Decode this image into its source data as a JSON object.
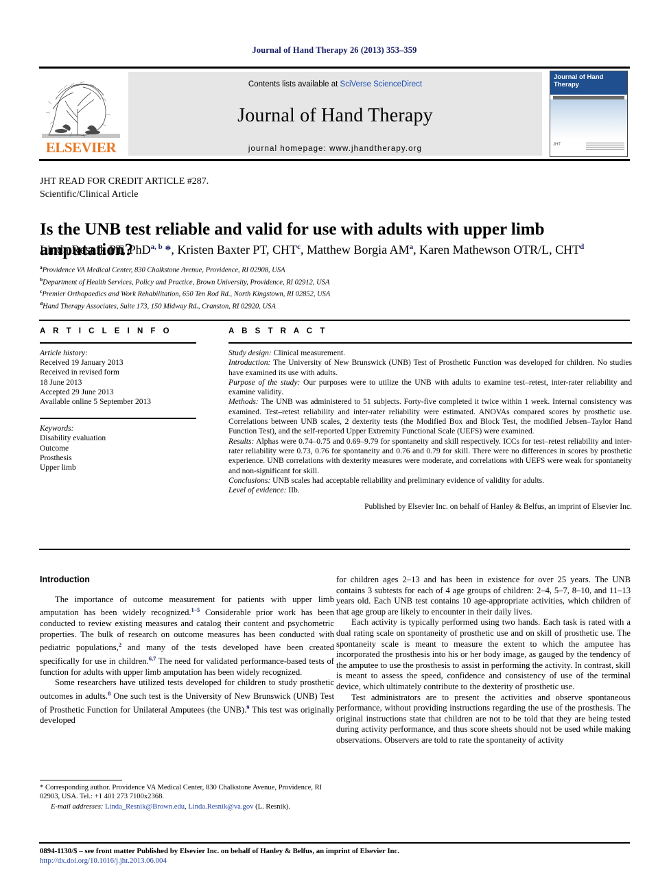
{
  "running_head": "Journal of Hand Therapy 26 (2013) 353–359",
  "masthead": {
    "contents_prefix": "Contents lists available at ",
    "contents_link": "SciVerse ScienceDirect",
    "journal_name": "Journal of Hand Therapy",
    "homepage": "journal homepage: www.jhandtherapy.org",
    "publisher_logo_text": "ELSEVIER",
    "cover_title": "Journal of Hand Therapy"
  },
  "article_type": {
    "line1_prefix": "JHT R",
    "line1_sc1": "EAD FOR",
    "line1_mid": " C",
    "line1_sc2": "REDIT",
    "line1_mid2": " A",
    "line1_sc3": "RTICLE",
    "line1_suffix": " #287.",
    "line2": "Scientific/Clinical Article"
  },
  "title": "Is the UNB test reliable and valid for use with adults with upper limb amputation?",
  "authors": [
    {
      "name": "Linda Resnik PT, PhD",
      "sup": "a, b",
      "star": true
    },
    {
      "name": "Kristen Baxter PT, CHT",
      "sup": "c",
      "star": false
    },
    {
      "name": "Matthew Borgia AM",
      "sup": "a",
      "star": false
    },
    {
      "name": "Karen Mathewson OTR/L, CHT",
      "sup": "d",
      "star": false
    }
  ],
  "affiliations": [
    {
      "mark": "a",
      "text": "Providence VA Medical Center, 830 Chalkstone Avenue, Providence, RI 02908, USA"
    },
    {
      "mark": "b",
      "text": "Department of Health Services, Policy and Practice, Brown University, Providence, RI 02912, USA"
    },
    {
      "mark": "c",
      "text": "Premier Orthopaedics and Work Rehabilitation, 650 Ten Rod Rd., North Kingstown, RI 02852, USA"
    },
    {
      "mark": "d",
      "text": "Hand Therapy Associates, Suite 173, 150 Midway Rd., Cranston, RI 02920, USA"
    }
  ],
  "article_info": {
    "heading": "A R T I C L E   I N F O",
    "history_label": "Article history:",
    "history": [
      "Received 19 January 2013",
      "Received in revised form",
      "18 June 2013",
      "Accepted 29 June 2013",
      "Available online 5 September 2013"
    ],
    "keywords_label": "Keywords:",
    "keywords": [
      "Disability evaluation",
      "Outcome",
      "Prosthesis",
      "Upper limb"
    ]
  },
  "abstract": {
    "heading": "A B S T R A C T",
    "sections": [
      {
        "label": "Study design:",
        "text": " Clinical measurement."
      },
      {
        "label": "Introduction:",
        "text": " The University of New Brunswick (UNB) Test of Prosthetic Function was developed for children. No studies have examined its use with adults."
      },
      {
        "label": "Purpose of the study:",
        "text": " Our purposes were to utilize the UNB with adults to examine test–retest, inter-rater reliability and examine validity."
      },
      {
        "label": "Methods:",
        "text": " The UNB was administered to 51 subjects. Forty-five completed it twice within 1 week. Internal consistency was examined. Test–retest reliability and inter-rater reliability were estimated. ANOVAs compared scores by prosthetic use. Correlations between UNB scales, 2 dexterity tests (the Modified Box and Block Test, the modified Jebsen–Taylor Hand Function Test), and the self-reported Upper Extremity Functional Scale (UEFS) were examined."
      },
      {
        "label": "Results:",
        "text": " Alphas were 0.74–0.75 and 0.69–9.79 for spontaneity and skill respectively. ICCs for test–retest reliability and inter-rater reliability were 0.73, 0.76 for spontaneity and 0.76 and 0.79 for skill. There were no differences in scores by prosthetic experience. UNB correlations with dexterity measures were moderate, and correlations with UEFS were weak for spontaneity and non-significant for skill."
      },
      {
        "label": "Conclusions:",
        "text": " UNB scales had acceptable reliability and preliminary evidence of validity for adults."
      },
      {
        "label": "Level of evidence:",
        "text": " IIb."
      }
    ],
    "publisher_line": "Published by Elsevier Inc. on behalf of Hanley & Belfus, an imprint of Elsevier Inc."
  },
  "body": {
    "left": {
      "heading": "Introduction",
      "paragraphs": [
        "The importance of outcome measurement for patients with upper limb amputation has been widely recognized.<sup>1–5</sup> Considerable prior work has been conducted to review existing measures and catalog their content and psychometric properties. The bulk of research on outcome measures has been conducted with pediatric populations,<sup>2</sup> and many of the tests developed have been created specifically for use in children.<sup>6,7</sup> The need for validated performance-based tests of function for adults with upper limb amputation has been widely recognized.",
        "Some researchers have utilized tests developed for children to study prosthetic outcomes in adults.<sup>8</sup> One such test is the University of New Brunswick (UNB) Test of Prosthetic Function for Unilateral Amputees (the UNB).<sup>9</sup> This test was originally developed"
      ]
    },
    "right": {
      "paragraphs": [
        "for children ages 2–13 and has been in existence for over 25 years. The UNB contains 3 subtests for each of 4 age groups of children: 2–4, 5–7, 8–10, and 11–13 years old. Each UNB test contains 10 age-appropriate activities, which children of that age group are likely to encounter in their daily lives.",
        "Each activity is typically performed using two hands. Each task is rated with a dual rating scale on spontaneity of prosthetic use and on skill of prosthetic use. The spontaneity scale is meant to measure the extent to which the amputee has incorporated the prosthesis into his or her body image, as gauged by the tendency of the amputee to use the prosthesis to assist in performing the activity. In contrast, skill is meant to assess the speed, confidence and consistency of use of the terminal device, which ultimately contribute to the dexterity of prosthetic use.",
        "Test administrators are to present the activities and observe spontaneous performance, without providing instructions regarding the use of the prosthesis. The original instructions state that children are not to be told that they are being tested during activity performance, and thus score sheets should not be used while making observations. Observers are told to rate the spontaneity of activity"
      ]
    }
  },
  "footnotes": {
    "corresponding": "* Corresponding author. Providence VA Medical Center, 830 Chalkstone Avenue, Providence, RI 02903, USA. Tel.: +1 401 273 7100x2368.",
    "email_label": "E-mail addresses:",
    "email1": "Linda_Resnik@Brown.edu",
    "email2": "Linda.Resnik@va.gov",
    "email_suffix": " (L. Resnik)."
  },
  "bottom": {
    "front_matter": "0894-1130/$ – see front matter Published by Elsevier Inc. on behalf of Hanley & Belfus, an imprint of Elsevier Inc.",
    "doi": "http://dx.doi.org/10.1016/j.jht.2013.06.004"
  },
  "colors": {
    "link": "#1f3fa0",
    "header_navy": "#141b62",
    "elsevier_orange": "#E87722",
    "panel_gray": "#e6e6e6",
    "cover_blue": "#1f4f8f"
  }
}
